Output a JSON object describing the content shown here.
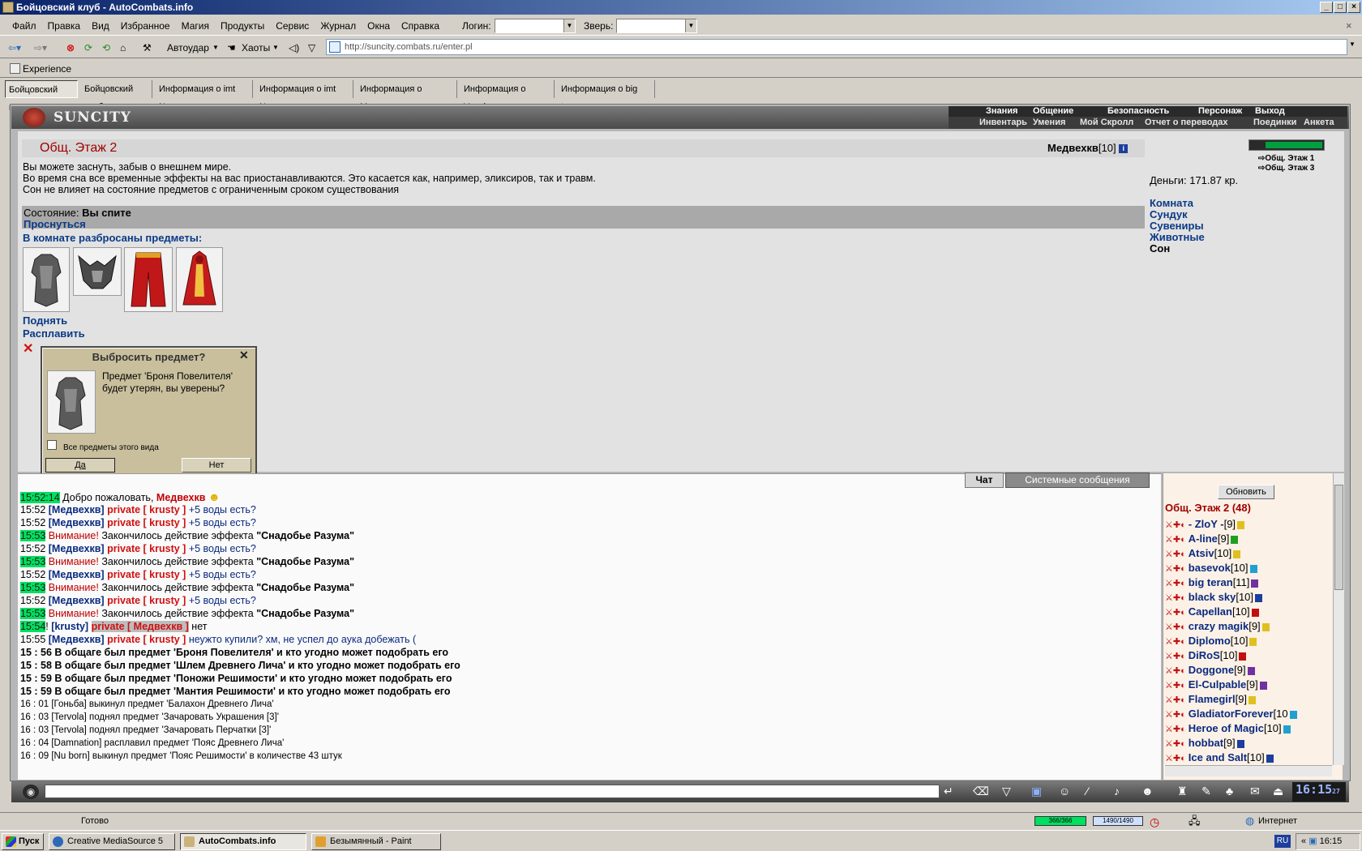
{
  "window": {
    "title": "Бойцовский клуб - AutoCombats.info"
  },
  "menu": {
    "items": [
      "Файл",
      "Правка",
      "Вид",
      "Избранное",
      "Магия",
      "Продукты",
      "Сервис",
      "Журнал",
      "Окна",
      "Справка"
    ],
    "login_label": "Логин:",
    "beast_label": "Зверь:"
  },
  "toolbar": {
    "autoudar": "Автоудар",
    "haoty": "Хаоты"
  },
  "address": {
    "url": "http://suncity.combats.ru/enter.pl"
  },
  "links": {
    "experience": "Experience"
  },
  "tabs": [
    "Бойцовский клуб",
    "Бойцовский клуб",
    "Информация о imt Never",
    "Информация о imt Never",
    "Информация о Медвехкв",
    "Информация о Voyajer",
    "Информация о big teran"
  ],
  "game": {
    "logo": "SUNCITY",
    "nav_top": [
      "Знания",
      "Общение",
      "Безопасность",
      "Персонаж",
      "Выход"
    ],
    "nav_bottom": [
      "Инвентарь",
      "Умения",
      "Мой Скролл",
      "Отчет о переводах",
      "Поединки",
      "Анкета"
    ],
    "location": "Общ. Этаж 2",
    "character": "Медвехкв",
    "character_level": "[10]",
    "sleep_lines": [
      "Вы можете заснуть, забыв о внешнем мире.",
      "Во время сна все временные эффекты на вас приостанавливаются. Это касается как, например, эликсиров, так и травм.",
      "Сон не влияет на состояние предметов с ограниченным сроком существования"
    ],
    "state_label": "Состояние:",
    "state_value": "Вы спите",
    "wake": "Проснуться",
    "items_heading": "В комнате разбросаны предметы:",
    "pickup": "Поднять",
    "melt": "Расплавить",
    "floors": [
      "Общ. Этаж 1",
      "Общ. Этаж 3"
    ],
    "money": "Деньги: 171.87 кр.",
    "right_links": [
      "Комната",
      "Сундук",
      "Сувениры",
      "Животные",
      "Сон"
    ]
  },
  "dialog": {
    "title": "Выбросить предмет?",
    "message": "Предмет 'Броня Повелителя' будет утерян, вы уверены?",
    "checkbox": "Все предметы этого вида",
    "yes": "Да",
    "no": "Нет"
  },
  "chat": {
    "tab_chat": "Чат",
    "tab_system": "Системные сообщения",
    "welcome_time": "15:52:14",
    "welcome_text": "Добро пожаловать,",
    "welcome_name": "Медвехкв",
    "private_lines": [
      {
        "time": "15:52",
        "name": "[Медвехкв]",
        "pr": "private [ krusty ]",
        "text": "+5 воды есть?"
      },
      {
        "time": "15:52",
        "name": "[Медвехкв]",
        "pr": "private [ krusty ]",
        "text": "+5 воды есть?"
      }
    ],
    "warn_label": "Внимание!",
    "effect_text": "Закончилось действие эффекта",
    "effect_name": "\"Снадобье Разума\"",
    "repeat_line": {
      "time": "15:52",
      "name": "[Медвехкв]",
      "pr": "private [ krusty ]",
      "text": "+5 воды есть?"
    },
    "warn_time": "15:53",
    "reply": {
      "time": "15:54",
      "pre": "!",
      "name": "[krusty]",
      "pr": "private [ Медвехкв ]",
      "text": "нет"
    },
    "last_private": {
      "time": "15:55",
      "name": "[Медвехкв]",
      "pr": "private [ krusty ]",
      "text": "неужто купили? хм, не успел до аука добежать ("
    },
    "system_bold": [
      "15 : 56 В общаге был предмет 'Броня Повелителя' и кто угодно может подобрать его",
      "15 : 58 В общаге был предмет 'Шлем Древнего Лича' и кто угодно может подобрать его",
      "15 : 59 В общаге был предмет 'Поножи Решимости' и кто угодно может подобрать его",
      "15 : 59 В общаге был предмет 'Мантия Решимости' и кто угодно может подобрать его"
    ],
    "system_plain": [
      "16 : 01 [Гоньба] выкинул предмет 'Балахон Древнего Лича'",
      "16 : 03 [Tervola] поднял предмет 'Зачаровать Украшения [3]'",
      "16 : 03 [Tervola] поднял предмет 'Зачаровать Перчатки [3]'",
      "16 : 04 [Damnation] расплавил предмет 'Пояс Древнего Лича'",
      "16 : 09 [Nu born] выкинул предмет 'Пояс Решимости' в количестве 43 штук"
    ]
  },
  "users": {
    "refresh": "Обновить",
    "room": "Общ. Этаж 2 (48)",
    "list": [
      {
        "name": "- ZloY -",
        "lvl": "[9]"
      },
      {
        "name": "A-line",
        "lvl": "[9]"
      },
      {
        "name": "Atsiv",
        "lvl": "[10]"
      },
      {
        "name": "basevok",
        "lvl": "[10]"
      },
      {
        "name": "big teran",
        "lvl": "[11]"
      },
      {
        "name": "black sky",
        "lvl": "[10]"
      },
      {
        "name": "Capellan",
        "lvl": "[10]"
      },
      {
        "name": "crazy magik",
        "lvl": "[9]"
      },
      {
        "name": "Diplomo",
        "lvl": "[10]"
      },
      {
        "name": "DiRoS",
        "lvl": "[10]"
      },
      {
        "name": "Doggone",
        "lvl": "[9]"
      },
      {
        "name": "El-Culpable",
        "lvl": "[9]"
      },
      {
        "name": "Flamegirl",
        "lvl": "[9]"
      },
      {
        "name": "GladiatorForever",
        "lvl": "[10"
      },
      {
        "name": "Heroe of Magic",
        "lvl": "[10]"
      },
      {
        "name": "hobbat",
        "lvl": "[9]"
      },
      {
        "name": "Ice and Salt",
        "lvl": "[10]"
      }
    ]
  },
  "clock": {
    "time": "16:15",
    "sec": "27"
  },
  "status": {
    "ready": "Готово",
    "hp": "366/366",
    "mana": "1490/1490",
    "zone": "Интернет"
  },
  "taskbar": {
    "start": "Пуск",
    "tasks": [
      "Creative MediaSource 5",
      "AutoCombats.info",
      "Безымянный - Paint"
    ],
    "lang": "RU",
    "time": "16:15"
  }
}
